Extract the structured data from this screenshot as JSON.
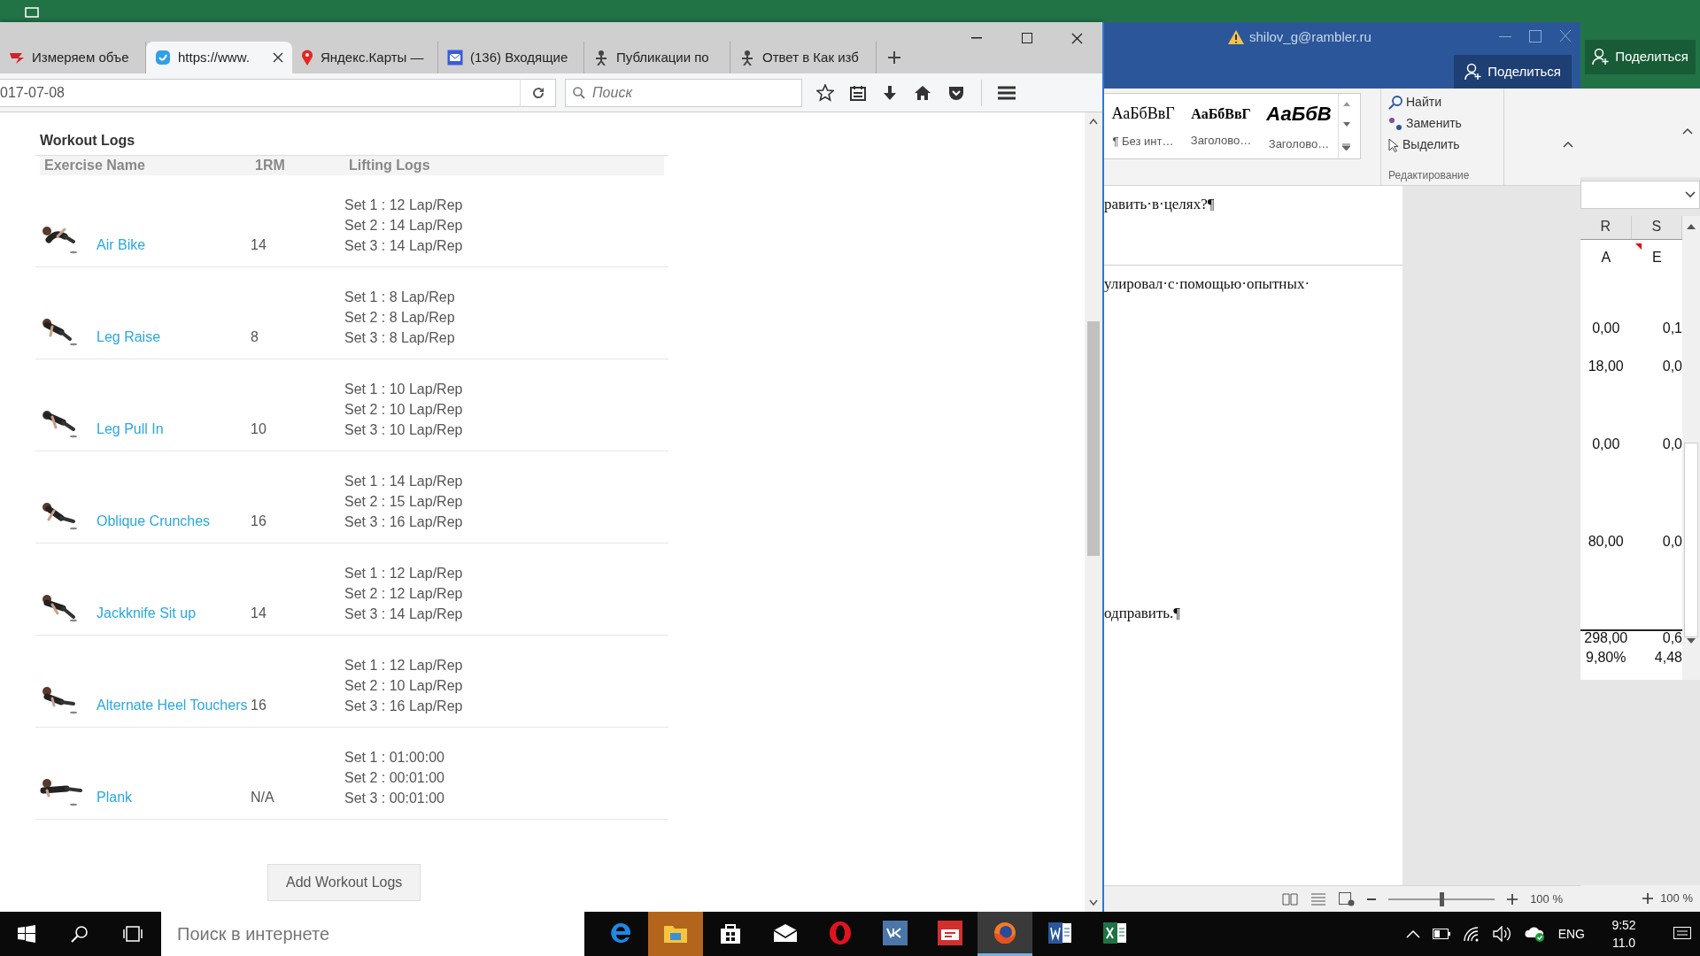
{
  "browser": {
    "tabs": [
      {
        "title": "Измеряем объе",
        "kind": "logo",
        "selected": false
      },
      {
        "title": "https://www.",
        "kind": "shield",
        "selected": true
      },
      {
        "title": "Яндекс.Карты —",
        "kind": "pin",
        "selected": false
      },
      {
        "title": "(136) Входящие",
        "kind": "mail",
        "selected": false
      },
      {
        "title": "Публикации по",
        "kind": "figure",
        "selected": false
      },
      {
        "title": "Ответ в Как изб",
        "kind": "figure",
        "selected": false
      }
    ],
    "address": "017-07-08",
    "search_placeholder": "Поиск"
  },
  "page": {
    "heading": "Workout Logs",
    "columns": [
      "Exercise Name",
      "1RM",
      "Lifting Logs"
    ],
    "rows": [
      {
        "name": "Air Bike",
        "one_rm": "14",
        "sets": [
          "Set 1 : 12 Lap/Rep",
          "Set 2 : 14 Lap/Rep",
          "Set 3 : 14 Lap/Rep"
        ]
      },
      {
        "name": "Leg Raise",
        "one_rm": "8",
        "sets": [
          "Set 1 : 8 Lap/Rep",
          "Set 2 : 8 Lap/Rep",
          "Set 3 : 8 Lap/Rep"
        ]
      },
      {
        "name": "Leg Pull In",
        "one_rm": "10",
        "sets": [
          "Set 1 : 10 Lap/Rep",
          "Set 2 : 10 Lap/Rep",
          "Set 3 : 10 Lap/Rep"
        ]
      },
      {
        "name": "Oblique Crunches",
        "one_rm": "16",
        "sets": [
          "Set 1 : 14 Lap/Rep",
          "Set 2 : 15 Lap/Rep",
          "Set 3 : 16 Lap/Rep"
        ]
      },
      {
        "name": "Jackknife Sit up",
        "one_rm": "14",
        "sets": [
          "Set 1 : 12 Lap/Rep",
          "Set 2 : 12 Lap/Rep",
          "Set 3 : 14 Lap/Rep"
        ]
      },
      {
        "name": "Alternate Heel Touchers",
        "one_rm": "16",
        "sets": [
          "Set 1 : 12 Lap/Rep",
          "Set 2 : 10 Lap/Rep",
          "Set 3 : 16 Lap/Rep"
        ]
      },
      {
        "name": "Plank",
        "one_rm": "N/A",
        "sets": [
          "Set 1 : 01:00:00",
          "Set 2 : 00:01:00",
          "Set 3 : 00:01:00"
        ]
      }
    ],
    "add_button": "Add Workout Logs"
  },
  "word": {
    "account": "shilov_g@rambler.ru",
    "share": "Поделиться",
    "styles": [
      {
        "sample": "АаБбВвГ",
        "label": "¶ Без инт…",
        "kind": "normal"
      },
      {
        "sample": "АаБбВвГ",
        "label": "Заголово…",
        "kind": "heading1"
      },
      {
        "sample": "АаБбВ",
        "label": "Заголово…",
        "kind": "heading2"
      }
    ],
    "editing": {
      "find": "Найти",
      "replace": "Заменить",
      "select": "Выделить",
      "group": "Редактирование"
    },
    "document_lines": [
      "равить·в·целях?¶",
      "улировал·с·помощью·опытных·",
      "одправить.¶"
    ],
    "zoom": "100 %",
    "zoom_slider": {
      "level": 0.5
    }
  },
  "excel": {
    "share": "Поделиться",
    "columns": [
      "R",
      "S"
    ],
    "rows": [
      [
        "A",
        "E"
      ],
      [
        "0,00",
        "0,1"
      ],
      [
        "18,00",
        "0,0"
      ],
      [
        "0,00",
        "0,0"
      ],
      [
        "80,00",
        "0,0"
      ],
      [
        "298,00",
        "0,6"
      ],
      [
        "9,80%",
        "4,48"
      ]
    ],
    "zoom": "100 %"
  },
  "taskbar": {
    "search_placeholder": "Поиск в интернете",
    "apps": [
      {
        "kind": "edge",
        "selected": false
      },
      {
        "kind": "explorer",
        "selected": false
      },
      {
        "kind": "store",
        "selected": false
      },
      {
        "kind": "mail",
        "selected": false
      },
      {
        "kind": "opera",
        "selected": false
      },
      {
        "kind": "vk",
        "selected": false
      },
      {
        "kind": "red",
        "selected": false
      },
      {
        "kind": "firefox",
        "selected": true
      },
      {
        "kind": "word",
        "selected": false
      },
      {
        "kind": "excel",
        "selected": false
      }
    ],
    "language": "ENG",
    "time": "9:52",
    "date": "11.0"
  }
}
